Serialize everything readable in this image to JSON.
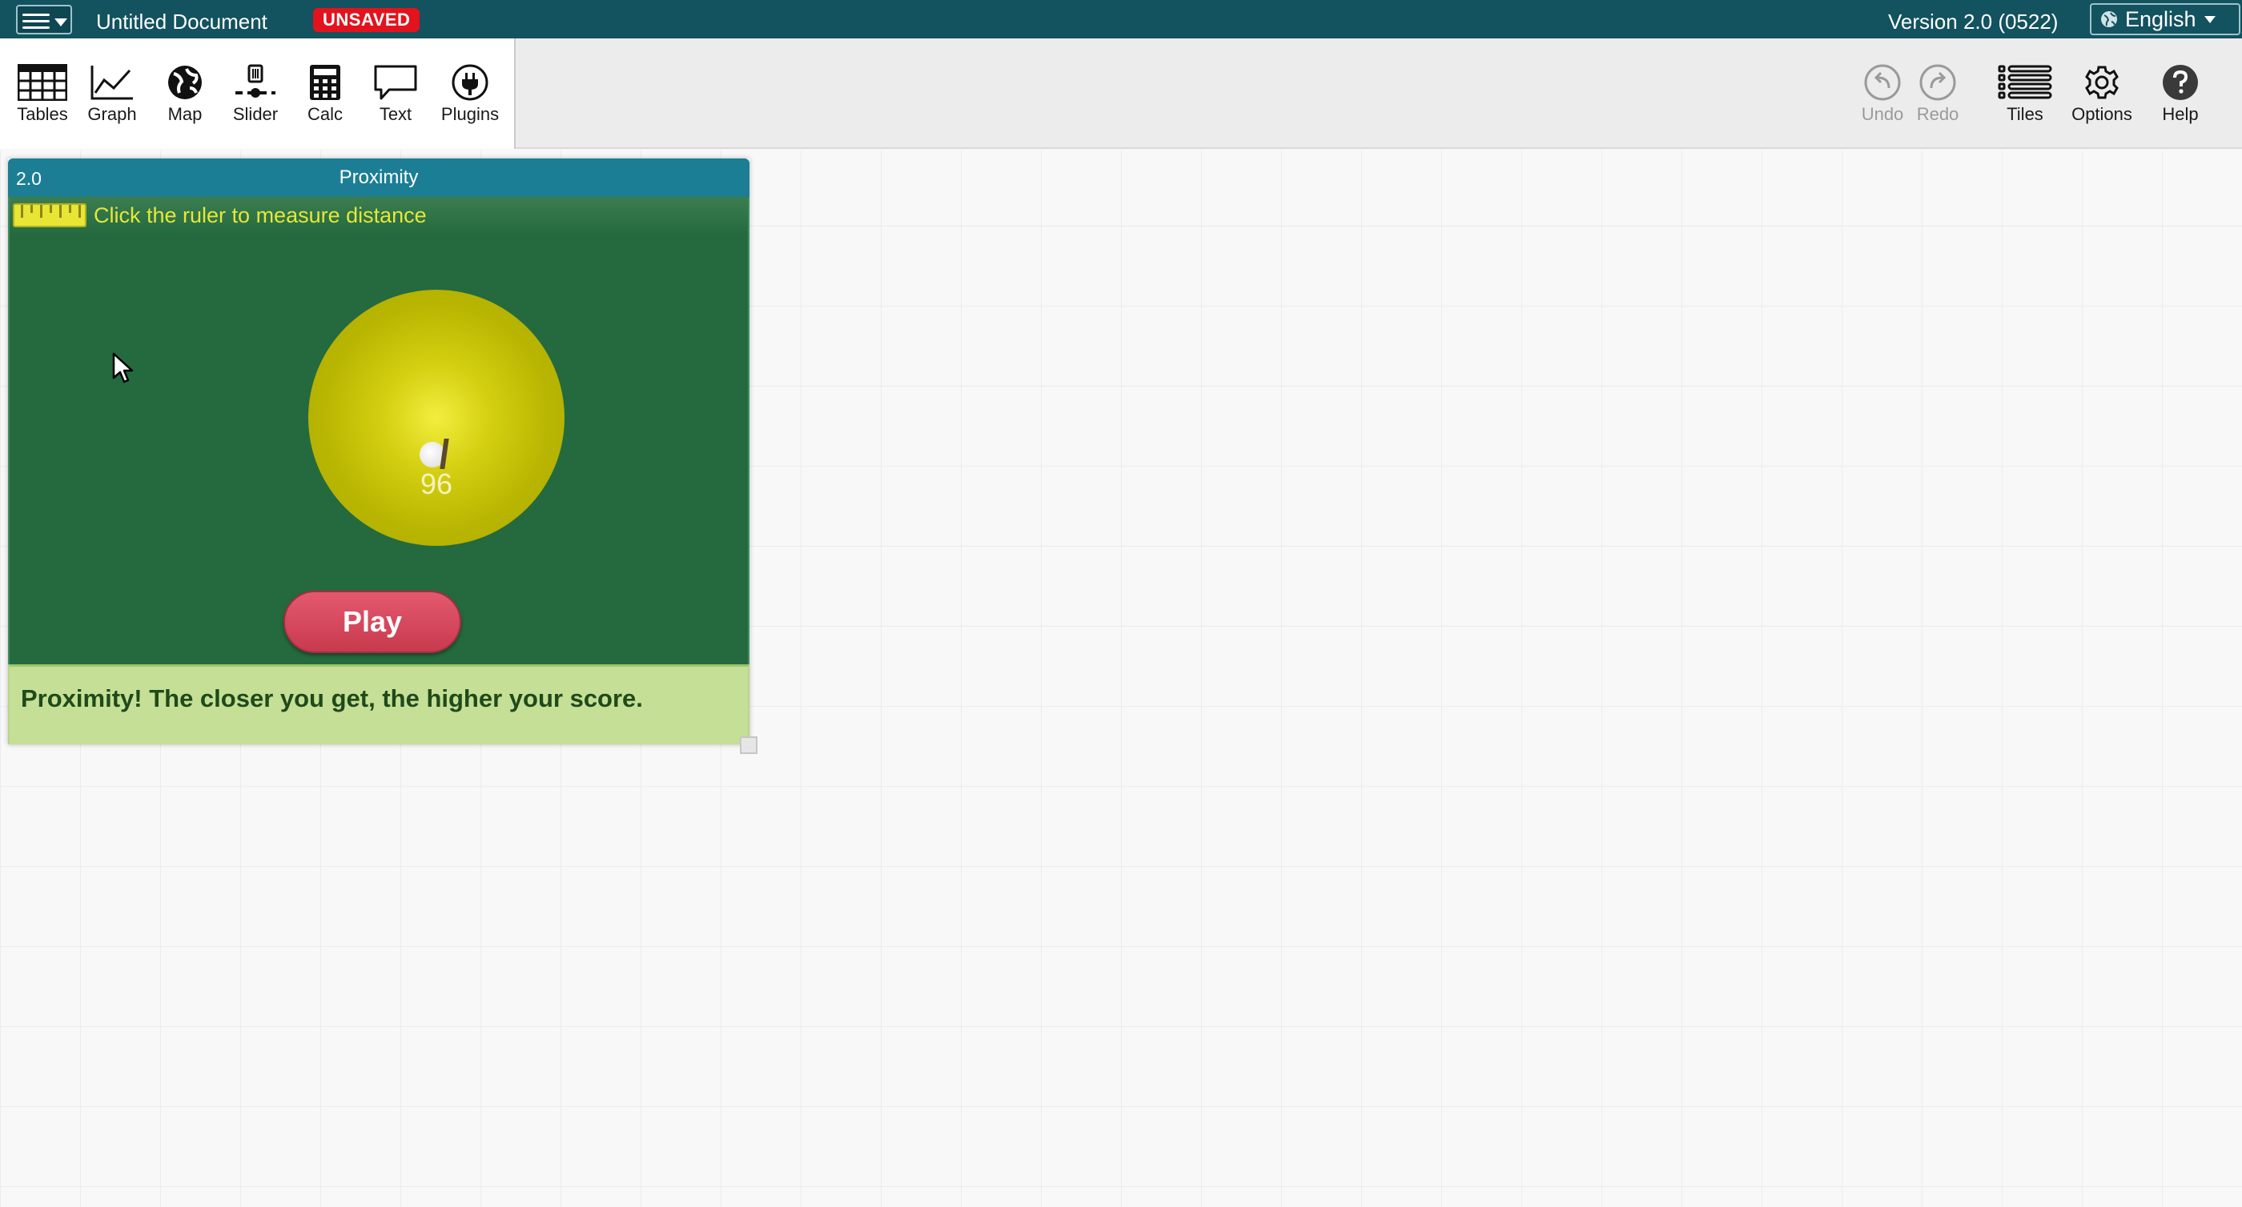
{
  "menubar": {
    "document_title": "Untitled Document",
    "status_badge": "UNSAVED",
    "version": "Version 2.0 (0522)",
    "language": "English",
    "background_color": "#13525f",
    "badge_color": "#e2131d"
  },
  "toolshelf": {
    "tools": [
      {
        "label": "Tables",
        "icon": "table-icon"
      },
      {
        "label": "Graph",
        "icon": "graph-icon"
      },
      {
        "label": "Map",
        "icon": "globe-icon"
      },
      {
        "label": "Slider",
        "icon": "slider-icon"
      },
      {
        "label": "Calc",
        "icon": "calculator-icon"
      },
      {
        "label": "Text",
        "icon": "speech-bubble-icon"
      },
      {
        "label": "Plugins",
        "icon": "plug-icon"
      }
    ],
    "right_tools": [
      {
        "label": "Undo",
        "icon": "undo-icon",
        "enabled": false
      },
      {
        "label": "Redo",
        "icon": "redo-icon",
        "enabled": false
      },
      {
        "label": "Tiles",
        "icon": "list-icon",
        "enabled": true
      },
      {
        "label": "Options",
        "icon": "gear-icon",
        "enabled": true
      },
      {
        "label": "Help",
        "icon": "help-icon",
        "enabled": true
      }
    ]
  },
  "tile": {
    "version": "2.0",
    "title": "Proximity",
    "titlebar_color": "#1c7e94",
    "game": {
      "ruler_hint": "Click the ruler to measure distance",
      "score": "96",
      "play_label": "Play",
      "field_color": "#246a3e",
      "target_color": "#c9c400",
      "play_color": "#d94a5f"
    },
    "message": "Proximity! The closer you get, the higher your score."
  }
}
